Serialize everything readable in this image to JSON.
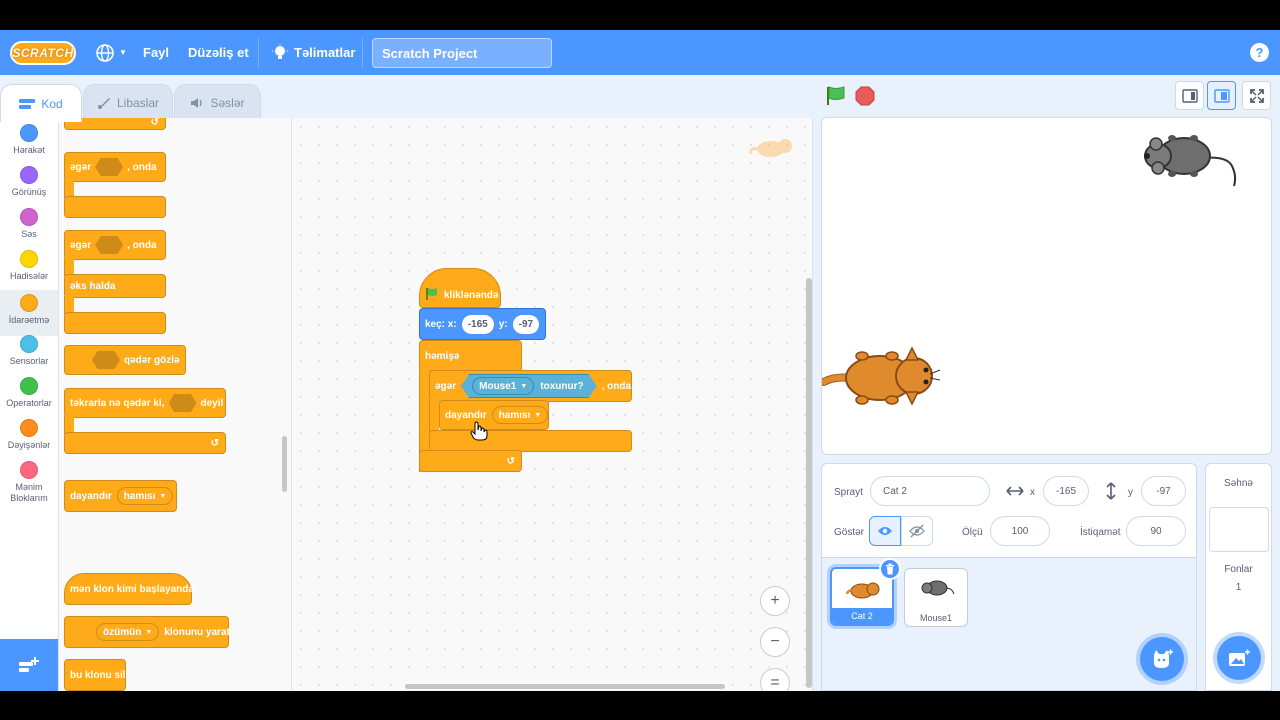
{
  "menubar": {
    "logo": "SCRATCH",
    "file": "Fayl",
    "edit": "Düzəliş et",
    "tutorials": "Təlimatlar",
    "project_title": "Scratch Project",
    "help": "?",
    "color": "#4c97ff"
  },
  "tabs": {
    "code": "Kod",
    "costumes": "Libaslar",
    "sounds": "Səslər"
  },
  "categories": [
    {
      "label": "Hərakət",
      "color": "#4c97ff"
    },
    {
      "label": "Görünüş",
      "color": "#9966ff"
    },
    {
      "label": "Səs",
      "color": "#cf63cf"
    },
    {
      "label": "Hadisələr",
      "color": "#ffd500"
    },
    {
      "label": "İdarəetmə",
      "color": "#ffab19"
    },
    {
      "label": "Sensorlar",
      "color": "#4cbfe6"
    },
    {
      "label": "Operatorlar",
      "color": "#40bf4a"
    },
    {
      "label": "Dəyişənlər",
      "color": "#ff8c1a"
    },
    {
      "label": "Mənim Bloklarım",
      "color": "#ff6680"
    }
  ],
  "palette": {
    "if_then": {
      "if": "əgər",
      "then": ", onda"
    },
    "if_else": {
      "if": "əgər",
      "then": ", onda",
      "else": "əks halda"
    },
    "wait_until": "qədər gözlə",
    "repeat_until": {
      "pre": "təkrarla nə qədər ki,",
      "post": "deyil"
    },
    "stop": {
      "label": "dayandır",
      "option": "hamısı"
    },
    "clone_start": "mən klon kimi başlayanda",
    "create_clone": {
      "option": "özümün",
      "label": "klonunu yarat"
    },
    "delete_clone": "bu klonu sil"
  },
  "script": {
    "hat": "kliklənəndə",
    "goto": {
      "label": "keç: x:",
      "x": "-165",
      "ylabel": "y:",
      "y": "-97"
    },
    "forever": "həmişə",
    "if": {
      "label": "əgər",
      "sensor": "Mouse1",
      "touching": "toxunur?",
      "then": ", onda"
    },
    "stop": {
      "label": "dayandır",
      "option": "hamısı"
    }
  },
  "zoom": {
    "in": "+",
    "out": "−",
    "reset": "="
  },
  "sprite_info": {
    "sprite_label": "Sprayt",
    "sprite_name": "Cat 2",
    "x_label": "x",
    "x": "-165",
    "y_label": "y",
    "y": "-97",
    "show_label": "Göstər",
    "size_label": "Ölçü",
    "size": "100",
    "direction_label": "İstiqamət",
    "direction": "90"
  },
  "sprites": [
    {
      "name": "Cat 2",
      "selected": true
    },
    {
      "name": "Mouse1",
      "selected": false
    }
  ],
  "stage_panel": {
    "title": "Səhnə",
    "backdrops_label": "Fonlar",
    "backdrops_count": "1"
  }
}
